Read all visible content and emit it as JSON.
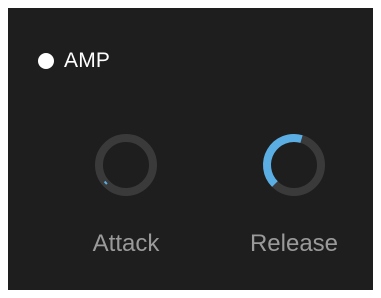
{
  "amp": {
    "title": "AMP",
    "enabled": true,
    "dot_color": "#ffffff",
    "text_color": "#ffffff"
  },
  "knobs": [
    {
      "id": "attack",
      "label": "Attack",
      "value": 0.02
    },
    {
      "id": "release",
      "label": "Release",
      "value": 0.42
    }
  ],
  "colors": {
    "panel_background": "#1e1e1e",
    "knob_track": "#3a3a3a",
    "knob_accent": "#5aaee3",
    "label_text": "#9a9a9a"
  }
}
